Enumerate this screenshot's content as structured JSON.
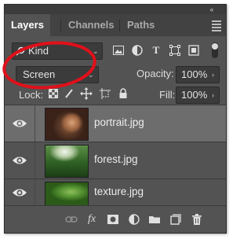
{
  "panel": {
    "collapse_glyph": "«",
    "tabs": [
      {
        "label": "Layers",
        "active": true
      },
      {
        "label": "Channels",
        "active": false
      },
      {
        "label": "Paths",
        "active": false
      }
    ],
    "menu_icon": "panel-menu-icon"
  },
  "filter_row": {
    "kind_label": "Kind",
    "filter_icons": [
      "pixel-filter-icon",
      "adjustment-filter-icon",
      "type-filter-icon",
      "shape-filter-icon",
      "smart-object-filter-icon"
    ]
  },
  "blend_row": {
    "blend_mode": "Screen",
    "opacity_label": "Opacity:",
    "opacity_value": "100%"
  },
  "lock_row": {
    "lock_label": "Lock:",
    "fill_label": "Fill:",
    "fill_value": "100%"
  },
  "layers": [
    {
      "name": "portrait.jpg",
      "selected": true,
      "visible": true
    },
    {
      "name": "forest.jpg",
      "selected": false,
      "visible": true
    },
    {
      "name": "texture.jpg",
      "selected": false,
      "visible": true
    }
  ],
  "bottom_bar": {
    "fx_label": "fx",
    "icons": [
      "link-layers-icon",
      "fx-icon",
      "add-mask-icon",
      "adjustment-layer-icon",
      "new-group-icon",
      "new-layer-icon",
      "trash-icon"
    ]
  },
  "annotation": {
    "color": "#e0101a"
  },
  "colors": {
    "panel_bg": "#535353",
    "selected_row": "#6d6d6d",
    "field_bg": "#3b3b3b"
  }
}
